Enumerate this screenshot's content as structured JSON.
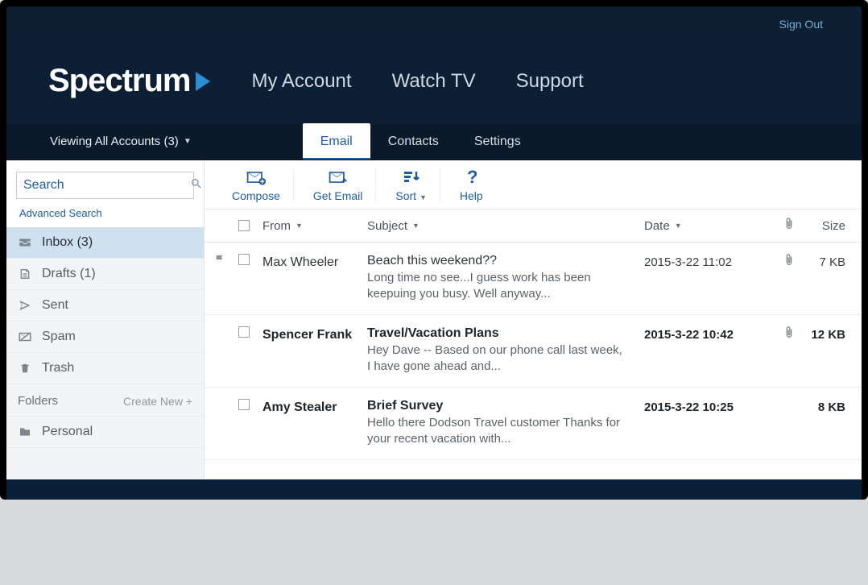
{
  "top": {
    "signout": "Sign Out"
  },
  "brand": {
    "name": "Spectrum"
  },
  "nav": {
    "account": "My Account",
    "watch": "Watch TV",
    "support": "Support"
  },
  "accounts": {
    "label": "Viewing All Accounts (3)"
  },
  "tabs": {
    "email": "Email",
    "contacts": "Contacts",
    "settings": "Settings"
  },
  "search": {
    "placeholder": "Search",
    "advanced": "Advanced Search"
  },
  "folders": {
    "inbox": "Inbox (3)",
    "drafts": "Drafts (1)",
    "sent": "Sent",
    "spam": "Spam",
    "trash": "Trash",
    "header": "Folders",
    "create": "Create New +",
    "personal": "Personal"
  },
  "tools": {
    "compose": "Compose",
    "get": "Get Email",
    "sort": "Sort",
    "help": "Help"
  },
  "cols": {
    "from": "From",
    "subject": "Subject",
    "date": "Date",
    "size": "Size"
  },
  "rows": [
    {
      "from": "Max Wheeler",
      "subject": "Beach this weekend??",
      "preview": "Long time no see...I guess work has been keepuing you busy. Well anyway...",
      "date": "2015-3-22 11:02",
      "size": "7 KB",
      "unread": false,
      "flag": true,
      "attach": true
    },
    {
      "from": "Spencer Frank",
      "subject": "Travel/Vacation Plans",
      "preview": "Hey Dave -- Based on our phone call last week, I have gone ahead and...",
      "date": "2015-3-22 10:42",
      "size": "12 KB",
      "unread": true,
      "flag": false,
      "attach": true
    },
    {
      "from": "Amy Stealer",
      "subject": "Brief Survey",
      "preview": "Hello there Dodson Travel customer Thanks for your recent vacation with...",
      "date": "2015-3-22 10:25",
      "size": "8 KB",
      "unread": true,
      "flag": false,
      "attach": false
    }
  ]
}
